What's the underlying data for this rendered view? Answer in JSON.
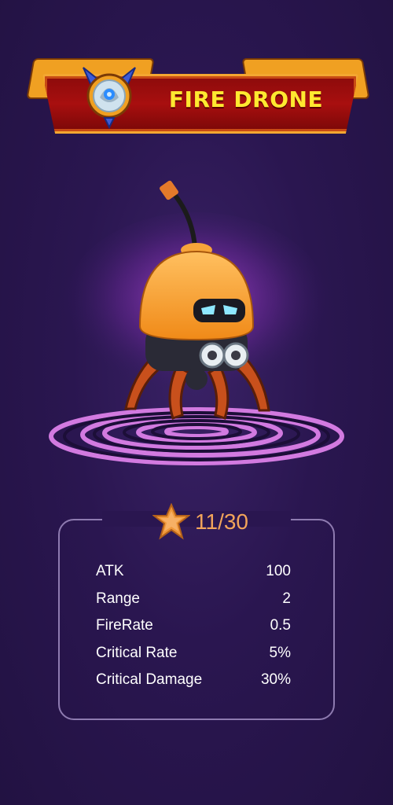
{
  "header": {
    "title": "FIRE DRONE"
  },
  "level": {
    "icon": "star-icon",
    "text": "11/30",
    "color": "#f2a45a"
  },
  "stats": [
    {
      "label": "ATK",
      "value": "100"
    },
    {
      "label": "Range",
      "value": "2"
    },
    {
      "label": "FireRate",
      "value": "0.5"
    },
    {
      "label": "Critical Rate",
      "value": "5%"
    },
    {
      "label": "Critical Damage",
      "value": "30%"
    }
  ],
  "colors": {
    "background": "#2a1650",
    "banner": "#a80f0f",
    "title": "#ffe830",
    "accent": "#f0a022"
  }
}
